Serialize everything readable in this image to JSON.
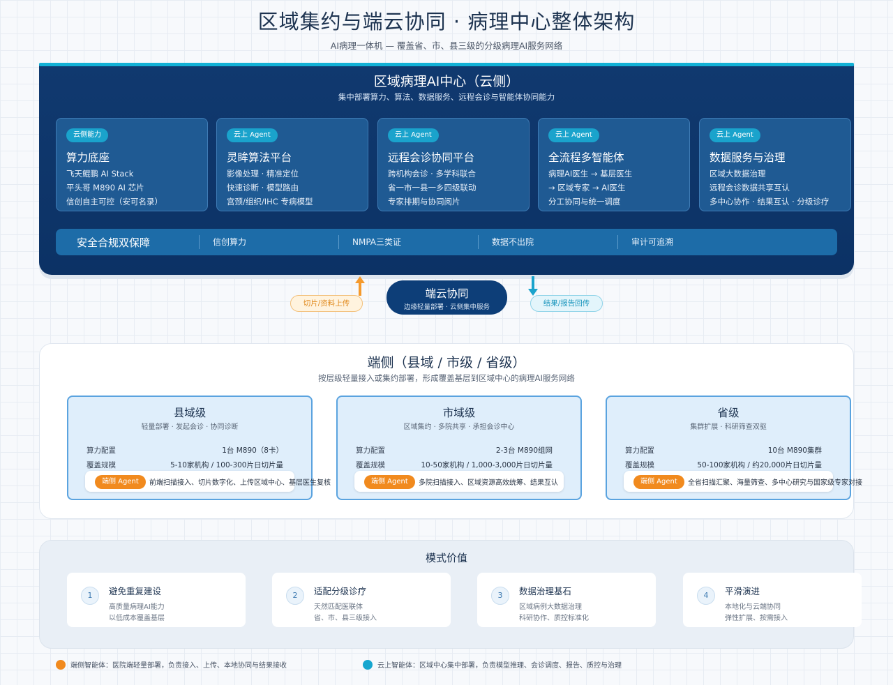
{
  "header": {
    "title": "区域集约与端云协同 · 病理中心整体架构",
    "subtitle": "AI病理一体机 — 覆盖省、市、县三级的分级病理AI服务网络"
  },
  "colors": {
    "cloud_panel": "#10396f",
    "accent_cyan": "#12b1d6",
    "cloud_card": "#1f5a93",
    "edge_card": "#dfeefb",
    "edge_agent_orange": "#f18a1e",
    "upload_orange": "#f59a2c",
    "result_cyan": "#1aa3cc"
  },
  "cloud": {
    "title": "区域病理AI中心（云侧）",
    "subtitle": "集中部署算力、算法、数据服务、远程会诊与智能体协同能力",
    "cards": [
      {
        "tag": "云侧能力",
        "title": "算力底座",
        "lines": [
          "飞天鲲鹏 AI Stack",
          "平头哥 M890 AI 芯片",
          "信创自主可控（安可名录）"
        ]
      },
      {
        "tag": "云上 Agent",
        "title": "灵眸算法平台",
        "lines": [
          "影像处理 · 精准定位",
          "快速诊断 · 模型路由",
          "宫颈/组织/IHC 专病模型"
        ]
      },
      {
        "tag": "云上 Agent",
        "title": "远程会诊协同平台",
        "lines": [
          "跨机构会诊 · 多学科联合",
          "省一市一县一乡四级联动",
          "专家排期与协同阅片"
        ]
      },
      {
        "tag": "云上 Agent",
        "title": "全流程多智能体",
        "lines": [
          "病理AI医生 → 基层医生",
          "→ 区域专家 → AI医生",
          "分工协同与统一调度"
        ]
      },
      {
        "tag": "云上 Agent",
        "title": "数据服务与治理",
        "lines": [
          "区域大数据治理",
          "远程会诊数据共享互认",
          "多中心协作 · 结果互认 · 分级诊疗"
        ]
      }
    ],
    "security": {
      "title": "安全合规双保障",
      "items": [
        "信创算力",
        "NMPA三类证",
        "数据不出院",
        "审计可追溯"
      ]
    }
  },
  "bridge": {
    "title": "端云协同",
    "subtitle": "边缘轻量部署 · 云侧集中服务",
    "upload_label": "切片/资料上传",
    "result_label": "结果/报告回传",
    "upload_icon": "arrow-up-icon",
    "result_icon": "arrow-down-icon"
  },
  "edge": {
    "title": "端侧（县域 / 市级 / 省级）",
    "subtitle": "按层级轻量接入或集约部署，形成覆盖基层到区域中心的病理AI服务网络",
    "compute_label": "算力配置",
    "coverage_label": "覆盖规模",
    "agent_tag": "端侧 Agent",
    "cards": [
      {
        "title": "县域级",
        "sub": "轻量部署 · 发起会诊 · 协同诊断",
        "compute": "1台 M890（8卡）",
        "coverage": "5-10家机构 / 100-300片日切片量",
        "agent_desc": "前端扫描接入、切片数字化、上传区域中心、基层医生复核"
      },
      {
        "title": "市域级",
        "sub": "区域集约 · 多院共享 · 承担会诊中心",
        "compute": "2-3台 M890组网",
        "coverage": "10-50家机构 / 1,000-3,000片日切片量",
        "agent_desc": "多院扫描接入、区域资源高效统筹、结果互认"
      },
      {
        "title": "省级",
        "sub": "集群扩展 · 科研筛查双驱",
        "compute": "10台 M890集群",
        "coverage": "50-100家机构 / 约20,000片日切片量",
        "agent_desc": "全省扫描汇聚、海量筛查、多中心研究与国家级专家对接"
      }
    ]
  },
  "value": {
    "title": "模式价值",
    "cards": [
      {
        "num": "1",
        "title": "避免重复建设",
        "l1": "高质量病理AI能力",
        "l2": "以低成本覆盖基层"
      },
      {
        "num": "2",
        "title": "适配分级诊疗",
        "l1": "天然匹配医联体",
        "l2": "省、市、县三级接入"
      },
      {
        "num": "3",
        "title": "数据治理基石",
        "l1": "区域病例大数据治理",
        "l2": "科研协作、质控标准化"
      },
      {
        "num": "4",
        "title": "平滑演进",
        "l1": "本地化与云端协同",
        "l2": "弹性扩展、按需接入"
      }
    ]
  },
  "legend": {
    "edge": "端侧智能体：医院端轻量部署，负责接入、上传、本地协同与结果接收",
    "cloud": "云上智能体：区域中心集中部署，负责模型推理、会诊调度、报告、质控与治理"
  }
}
